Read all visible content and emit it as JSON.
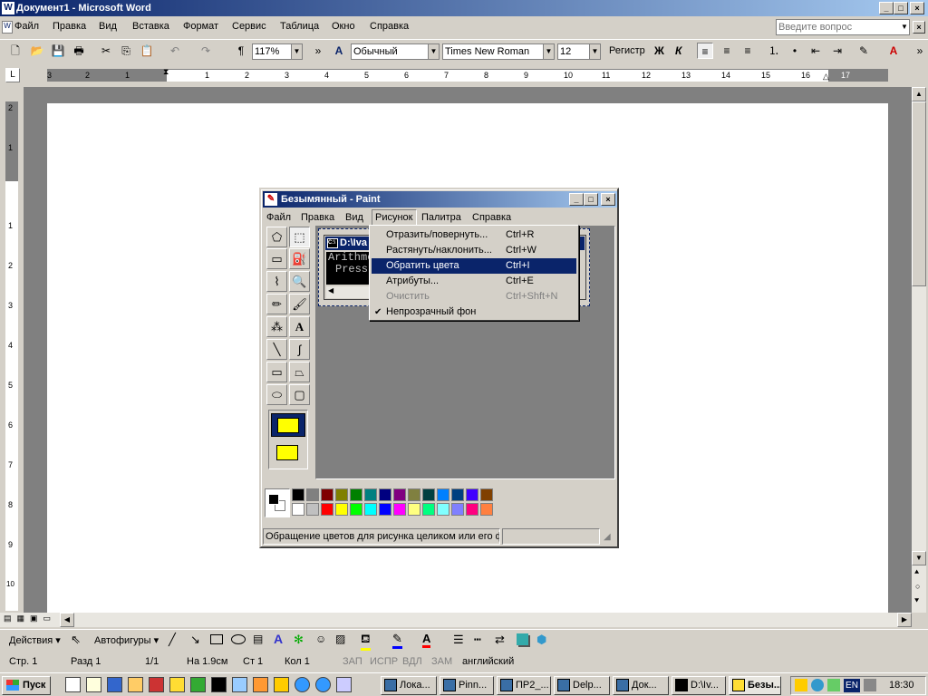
{
  "word": {
    "title": "Документ1 - Microsoft Word",
    "menu": [
      "Файл",
      "Правка",
      "Вид",
      "Вставка",
      "Формат",
      "Сервис",
      "Таблица",
      "Окно",
      "Справка"
    ],
    "help_placeholder": "Введите вопрос",
    "toolbar": {
      "zoom": "117%",
      "style": "Обычный",
      "font": "Times New Roman",
      "size": "12",
      "case_label": "Регистр",
      "bold": "Ж",
      "italic": "К"
    },
    "ruler_numbers": [
      "3",
      "2",
      "1",
      "1",
      "2",
      "3",
      "4",
      "5",
      "6",
      "7",
      "8",
      "9",
      "10",
      "11",
      "12",
      "13",
      "14",
      "15",
      "16",
      "17"
    ],
    "vruler_numbers": [
      "2",
      "1",
      "1",
      "2",
      "3",
      "4",
      "5",
      "6",
      "7",
      "8",
      "9",
      "10"
    ],
    "drawing": {
      "actions": "Действия",
      "autoshapes": "Автофигуры"
    },
    "status": {
      "page": "Стр. 1",
      "section": "Разд 1",
      "pages": "1/1",
      "at": "На 1.9см",
      "line": "Ст 1",
      "col": "Кол 1",
      "rec": "ЗАП",
      "trk": "ИСПР",
      "ext": "ВДЛ",
      "ovr": "ЗАМ",
      "lang": "английский"
    }
  },
  "paint": {
    "title": "Безымянный - Paint",
    "menu": [
      "Файл",
      "Правка",
      "Вид",
      "Рисунок",
      "Палитра",
      "Справка"
    ],
    "active_menu": "Рисунок",
    "canvas_window_title": "D:\\Iva",
    "canvas_lines": [
      "Arithme",
      "Press"
    ],
    "dropdown": [
      {
        "label": "Отразить/повернуть...",
        "shortcut": "Ctrl+R",
        "state": "normal"
      },
      {
        "label": "Растянуть/наклонить...",
        "shortcut": "Ctrl+W",
        "state": "normal"
      },
      {
        "label": "Обратить цвета",
        "shortcut": "Ctrl+I",
        "state": "selected"
      },
      {
        "label": "Атрибуты...",
        "shortcut": "Ctrl+E",
        "state": "normal"
      },
      {
        "label": "Очистить",
        "shortcut": "Ctrl+Shft+N",
        "state": "disabled"
      },
      {
        "label": "Непрозрачный фон",
        "shortcut": "",
        "state": "checked"
      }
    ],
    "status_text": "Обращение цветов для рисунка целиком или его ф",
    "palette_top": [
      "#000000",
      "#808080",
      "#800000",
      "#808000",
      "#008000",
      "#008080",
      "#000080",
      "#800080",
      "#808040",
      "#004040",
      "#0080ff",
      "#004080",
      "#4000ff",
      "#804000"
    ],
    "palette_bottom": [
      "#ffffff",
      "#c0c0c0",
      "#ff0000",
      "#ffff00",
      "#00ff00",
      "#00ffff",
      "#0000ff",
      "#ff00ff",
      "#ffff80",
      "#00ff80",
      "#80ffff",
      "#8080ff",
      "#ff0080",
      "#ff8040"
    ]
  },
  "taskbar": {
    "start": "Пуск",
    "tasks": [
      "Лока...",
      "Pinn...",
      "ПР2_...",
      "Delp...",
      "Док...",
      "D:\\Iv...",
      "Безы..."
    ],
    "lang": "EN",
    "time": "18:30"
  }
}
